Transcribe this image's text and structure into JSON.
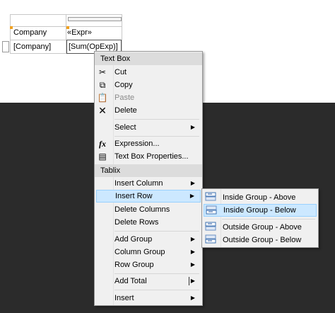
{
  "designer": {
    "cell_header_company": "Company",
    "cell_header_expr": "«Expr»",
    "cell_row_company": "[Company]",
    "cell_row_sum": "[Sum(OpExp)]"
  },
  "context_menu": {
    "header_textbox": "Text Box",
    "cut": "Cut",
    "copy": "Copy",
    "paste": "Paste",
    "delete": "Delete",
    "select": "Select",
    "expression": "Expression...",
    "textbox_properties": "Text Box Properties...",
    "header_tablix": "Tablix",
    "insert_column": "Insert Column",
    "insert_row": "Insert Row",
    "delete_columns": "Delete Columns",
    "delete_rows": "Delete Rows",
    "add_group": "Add Group",
    "column_group": "Column Group",
    "row_group": "Row Group",
    "add_total": "Add Total",
    "insert": "Insert"
  },
  "submenu_insert_row": {
    "inside_above": "Inside Group - Above",
    "inside_below": "Inside Group - Below",
    "outside_above": "Outside Group - Above",
    "outside_below": "Outside Group - Below"
  },
  "icons": {
    "cut": "scissors-icon",
    "copy": "copy-icon",
    "paste": "paste-icon",
    "delete": "delete-x-icon",
    "expression": "fx-icon",
    "properties": "properties-icon",
    "row": "insert-row-icon"
  },
  "colors": {
    "highlight": "#cce8ff",
    "highlight_border": "#99d1ff",
    "menu_bg": "#f0f0f0",
    "header_bg": "#dcdcdc",
    "handle": "#f0a020"
  }
}
